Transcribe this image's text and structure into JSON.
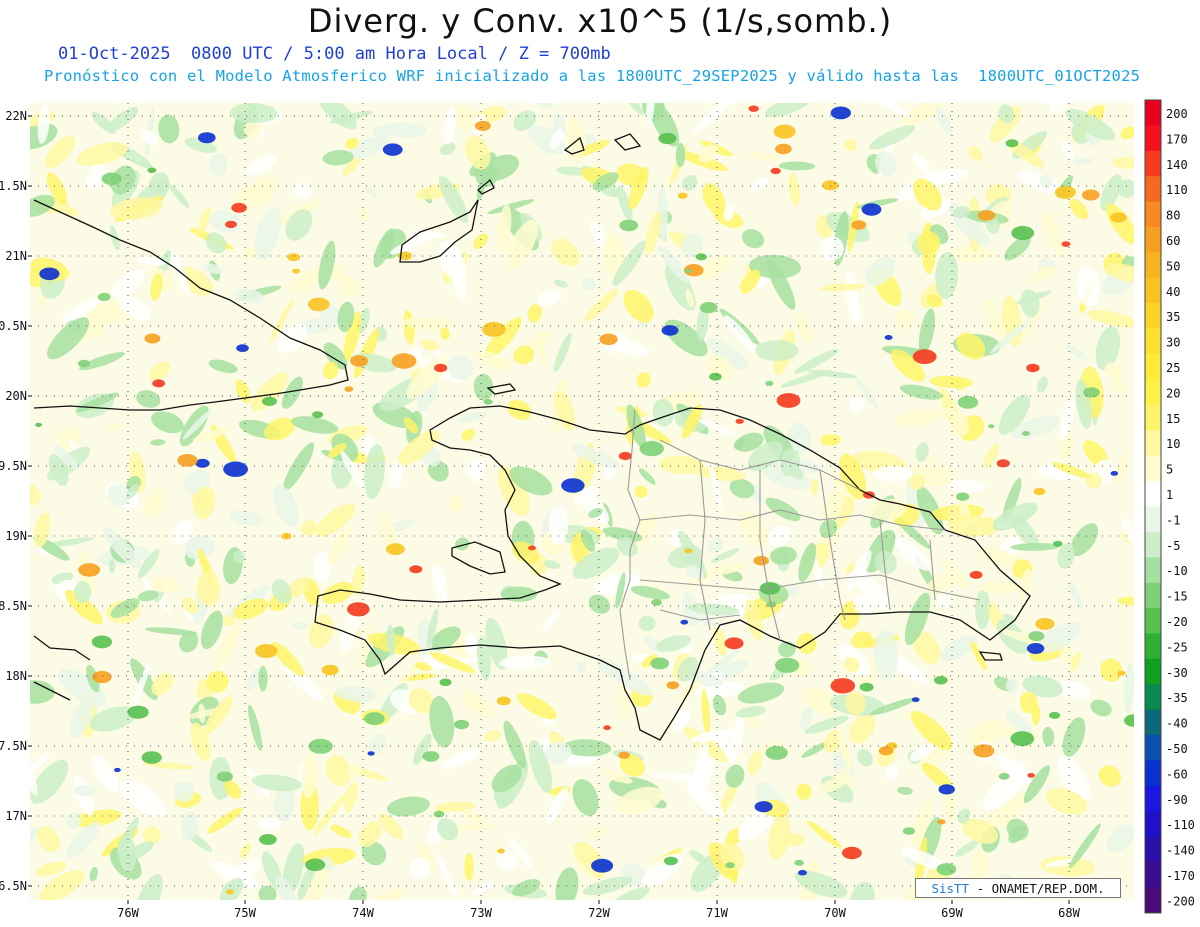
{
  "header": {
    "title": "Diverg. y Conv. x10^5 (1/s,somb.)",
    "valid_line": "01-Oct-2025  0800 UTC / 5:00 am Hora Local / Z = 700mb",
    "model_line": "Pronóstico con el Modelo Atmosferico WRF inicializado a las 1800UTC_29SEP2025 y válido hasta las  1800UTC_01OCT2025"
  },
  "map": {
    "lat_labels": [
      "22N",
      "1.5N",
      "21N",
      "0.5N",
      "20N",
      "9.5N",
      "19N",
      "8.5N",
      "18N",
      "7.5N",
      "17N",
      "6.5N"
    ],
    "lon_labels": [
      "76W",
      "75W",
      "74W",
      "73W",
      "72W",
      "71W",
      "70W",
      "69W",
      "68W"
    ],
    "gridlines": "dotted"
  },
  "colorbar": {
    "labels": [
      "200",
      "170",
      "140",
      "110",
      "80",
      "60",
      "50",
      "40",
      "35",
      "30",
      "25",
      "20",
      "15",
      "10",
      "5",
      "1",
      "-1",
      "-5",
      "-10",
      "-15",
      "-20",
      "-25",
      "-30",
      "-35",
      "-40",
      "-50",
      "-60",
      "-90",
      "-110",
      "-140",
      "-170",
      "-200"
    ],
    "colors": [
      "#e8001e",
      "#f5101e",
      "#f53a1e",
      "#f56a1e",
      "#f78a20",
      "#f7a020",
      "#f7b420",
      "#f9c420",
      "#fbd428",
      "#fde030",
      "#ffea38",
      "#fff048",
      "#fff468",
      "#fff8a0",
      "#fffcd0",
      "#ffffff",
      "#eaf6e8",
      "#cdeec8",
      "#a6e0a0",
      "#80d078",
      "#58c050",
      "#30b030",
      "#10a020",
      "#0a8a50",
      "#0a6a7a",
      "#0a50b0",
      "#0a30d0",
      "#1a18e0",
      "#2010c8",
      "#2a10a8",
      "#3a0c90",
      "#4a0a78"
    ]
  },
  "credit": {
    "brand": "SisTT",
    "org": " - ONAMET/REP.DOM."
  }
}
